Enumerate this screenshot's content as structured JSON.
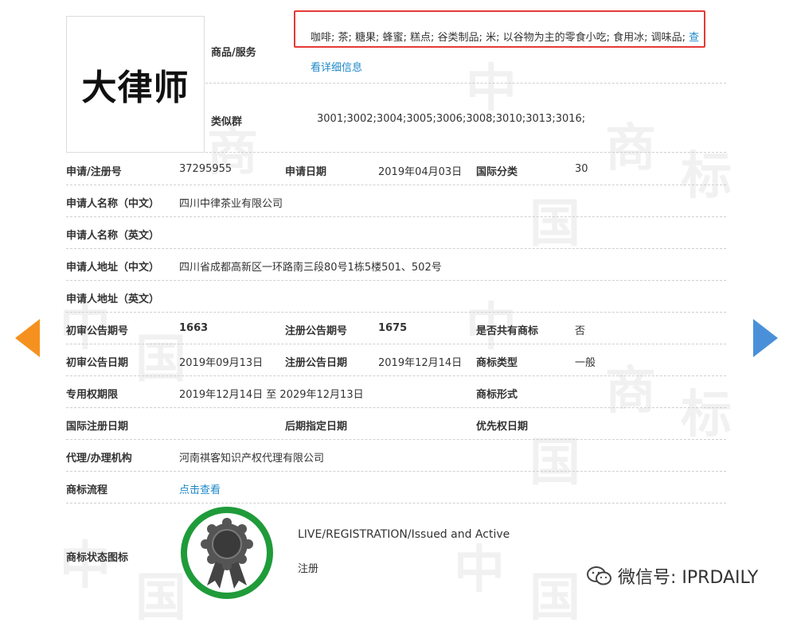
{
  "logo": {
    "text": "大律师"
  },
  "goods": {
    "label": "商品/服务",
    "text": "咖啡; 茶; 糖果; 蜂蜜; 糕点; 谷类制品; 米; 以谷物为主的零食小吃; 食用冰; 调味品;",
    "more": "查",
    "detail_link": "看详细信息"
  },
  "similar": {
    "label": "类似群",
    "value": "3001;3002;3004;3005;3006;3008;3010;3013;3016;"
  },
  "rows": {
    "reg_no": {
      "label": "申请/注册号",
      "value": "37295955"
    },
    "app_date": {
      "label": "申请日期",
      "value": "2019年04月03日"
    },
    "intl_class": {
      "label": "国际分类",
      "value": "30"
    },
    "applicant_cn": {
      "label": "申请人名称（中文）",
      "value": "四川中律茶业有限公司"
    },
    "applicant_en": {
      "label": "申请人名称（英文）",
      "value": ""
    },
    "address_cn": {
      "label": "申请人地址（中文）",
      "value": "四川省成都高新区一环路南三段80号1栋5楼501、502号"
    },
    "address_en": {
      "label": "申请人地址（英文）",
      "value": ""
    },
    "prelim_no": {
      "label": "初审公告期号",
      "value": "1663"
    },
    "reg_pub_no": {
      "label": "注册公告期号",
      "value": "1675"
    },
    "shared": {
      "label": "是否共有商标",
      "value": "否"
    },
    "prelim_date": {
      "label": "初审公告日期",
      "value": "2019年09月13日"
    },
    "reg_pub_date": {
      "label": "注册公告日期",
      "value": "2019年12月14日"
    },
    "tm_type": {
      "label": "商标类型",
      "value": "一般"
    },
    "exclusive": {
      "label": "专用权期限",
      "value": "2019年12月14日 至 2029年12月13日"
    },
    "tm_form": {
      "label": "商标形式",
      "value": ""
    },
    "intl_reg_date": {
      "label": "国际注册日期",
      "value": ""
    },
    "later_date": {
      "label": "后期指定日期",
      "value": ""
    },
    "priority_date": {
      "label": "优先权日期",
      "value": ""
    },
    "agency": {
      "label": "代理/办理机构",
      "value": "河南祺客知识产权代理有限公司"
    },
    "process": {
      "label": "商标流程",
      "link": "点击查看"
    },
    "status": {
      "label": "商标状态图标",
      "en": "LIVE/REGISTRATION/Issued and Active",
      "cn": "注册"
    }
  },
  "watermark": {
    "chars": [
      "中",
      "国",
      "商",
      "标"
    ]
  },
  "wechat": {
    "text": "微信号: IPRDAILY"
  },
  "colors": {
    "link": "#1e88c8",
    "highlight": "#e53935",
    "badge_ring": "#1f9b3a",
    "arrow_left": "#f5911e",
    "arrow_right": "#4a90d9"
  }
}
